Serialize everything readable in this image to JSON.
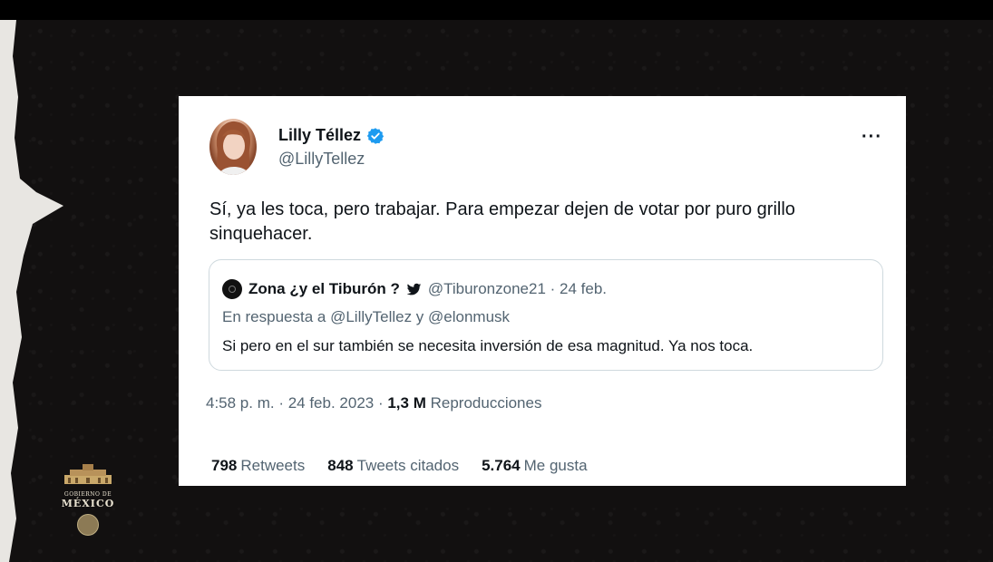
{
  "tweet": {
    "author_name": "Lilly Téllez",
    "author_handle": "@LillyTellez",
    "text": "Sí, ya les toca, pero trabajar. Para empezar dejen de votar por puro grillo sinquehacer.",
    "more_label": "···",
    "timestamp": "4:58 p. m. · 24 feb. 2023 · ",
    "views_count": "1,3 M",
    "views_label": "Reproducciones",
    "stats": {
      "retweets_count": "798",
      "retweets_label": "Retweets",
      "quotes_count": "848",
      "quotes_label": "Tweets citados",
      "likes_count": "5.764",
      "likes_label": "Me gusta"
    }
  },
  "quoted_tweet": {
    "author_name": "Zona ¿y el Tiburón ?",
    "meta": "@Tiburonzone21 · 24 feb.",
    "reply_to": "En respuesta a @LillyTellez y @elonmusk",
    "text": "Si pero en el sur también se necesita inversión de esa magnitud. Ya nos toca."
  },
  "logo": {
    "line1": "GOBIERNO DE",
    "line2": "MÉXICO"
  },
  "colors": {
    "verified": "#1d9bf0",
    "secondary_text": "#536471",
    "primary_text": "#0f1419",
    "border": "#cfd9de"
  },
  "icons": [
    "verified-badge-icon",
    "more-options-icon",
    "bird-icon",
    "government-building-icon",
    "seal-icon"
  ]
}
